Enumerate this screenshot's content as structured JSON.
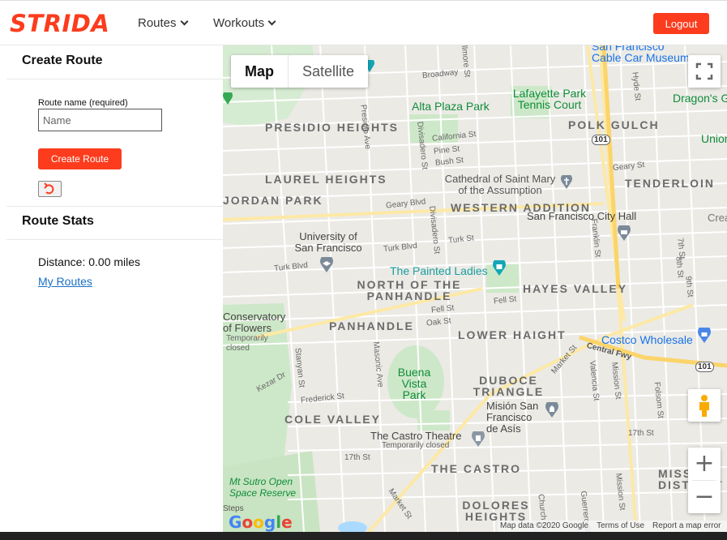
{
  "header": {
    "logo": "STRIDA",
    "nav_routes": "Routes",
    "nav_workouts": "Workouts",
    "logout": "Logout"
  },
  "sidebar": {
    "create_route_title": "Create Route",
    "route_name_label": "Route name (required)",
    "route_name_placeholder": "Name",
    "route_name_value": "",
    "create_button": "Create Route",
    "undo_icon": "undo-icon",
    "stats_title": "Route Stats",
    "distance": "Distance: 0.00 miles",
    "my_routes_link": "My Routes"
  },
  "map": {
    "map_type_map": "Map",
    "map_type_satellite": "Satellite",
    "zoom_in": "+",
    "zoom_out": "−",
    "attribution_data": "Map data ©2020 Google",
    "terms": "Terms of Use",
    "report": "Report a map error",
    "google_logo": "Google",
    "labels": {
      "presidio_heights": "PRESIDIO HEIGHTS",
      "laurel_heights": "LAUREL HEIGHTS",
      "jordan_park": "JORDAN PARK",
      "western_addition": "WESTERN ADDITION",
      "polk_gulch": "POLK GULCH",
      "tenderloin": "TENDERLOIN",
      "north_panhandle": "NORTH OF THE PANHANDLE",
      "hayes_valley": "HAYES VALLEY",
      "panhandle": "PANHANDLE",
      "lower_haight": "LOWER HAIGHT",
      "duboce_triangle": "DUBOCE TRIANGLE",
      "cole_valley": "COLE VALLEY",
      "the_castro": "THE CASTRO",
      "mission_district": "MISSION DISTRICT",
      "dolores_heights": "DOLORES HEIGHTS",
      "cable_car_museum": "Cable Car Museum",
      "san_francisco": "San Francisco",
      "alta_plaza_park": "Alta Plaza Park",
      "lafayette_park": "Lafayette Park Tennis Court",
      "cathedral": "Cathedral of Saint Mary of the Assumption",
      "city_hall": "San Francisco City Hall",
      "usf": "University of San Francisco",
      "painted_ladies": "The Painted Ladies",
      "conservatory": "Conservatory of Flowers",
      "temporarily_closed": "Temporarily closed",
      "buena_vista": "Buena Vista Park",
      "costco": "Costco Wholesale",
      "mision_san_francisco": "Misión San Francisco de Asís",
      "castro_theatre": "The Castro Theatre",
      "mt_sutro": "Mt Sutro Open Space Reserve",
      "dragons_gate": "Dragon's G",
      "union": "Union",
      "central_fwy": "Central Fwy",
      "broadway": "Broadway",
      "california_st": "California St",
      "pine_st": "Pine St",
      "bush_st": "Bush St",
      "geary_blvd": "Geary Blvd",
      "geary_st": "Geary St",
      "turk_blvd": "Turk Blvd",
      "turk_st": "Turk St",
      "fell_st": "Fell St",
      "oak_st": "Oak St",
      "frederick_st": "Frederick St",
      "kezar_dr": "Kezar Dr",
      "seventeenth_st": "17th St",
      "market_st": "Market St",
      "presidio_ave": "Presidio Ave",
      "divisadero_st": "Divisadero St",
      "masonic_ave": "Masonic Ave",
      "stanyan_st": "Stanyan St",
      "franklin_st": "Franklin St",
      "valencia_st": "Valencia St",
      "mission_st": "Mission St",
      "folsom_st": "Folsom St",
      "hyde_st": "Hyde St",
      "seventh_st": "7th St",
      "eighth_st": "8th St",
      "ninth_st": "9th St",
      "guerrero_st": "Guerrero St",
      "church_st": "Church St",
      "fillmore_st": "Fillmore St",
      "steps": "Steps",
      "hwy_101": "101",
      "crea": "Crea"
    }
  }
}
